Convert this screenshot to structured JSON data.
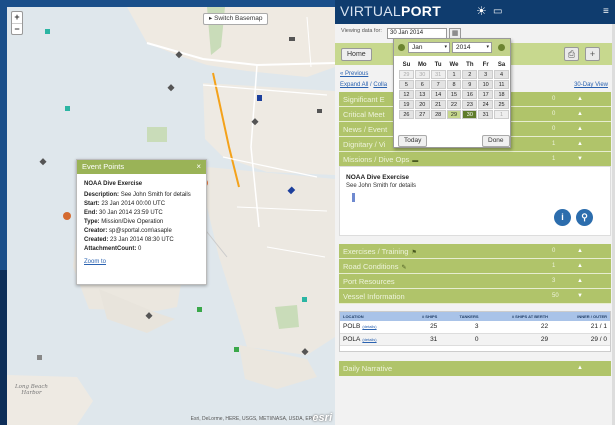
{
  "app": {
    "brand_part1": "VIRTUAL",
    "brand_part2": "PORT"
  },
  "map": {
    "basemap_button": "▸ Switch Basemap",
    "zoom_in": "+",
    "zoom_out": "−",
    "attribution": "Esri, DeLorme, HERE, USGS, METI/NASA, USDA, EPA",
    "esri_logo": "esri",
    "place_label": "Long Beach\nHarbor",
    "popup": {
      "header": "Event Points",
      "close": "×",
      "title": "NOAA Dive Exercise",
      "rows": [
        {
          "label": "Description:",
          "value": "See John Smith for details"
        },
        {
          "label": "Start:",
          "value": "23 Jan 2014 00:00 UTC"
        },
        {
          "label": "End:",
          "value": "30 Jan 2014 23:59 UTC"
        },
        {
          "label": "Type:",
          "value": "Mission/Dive Operation"
        },
        {
          "label": "Creator:",
          "value": "sp@sportal.com\\asaple"
        },
        {
          "label": "Created:",
          "value": "23 Jan 2014 08:30 UTC"
        },
        {
          "label": "AttachmentCount:",
          "value": "0"
        }
      ],
      "zoom_link": "Zoom to"
    }
  },
  "viewing": {
    "label": "Viewing data for:",
    "date": "30 Jan 2014"
  },
  "toolbar": {
    "home": "Home"
  },
  "nav": {
    "previous": "« Previous",
    "expand_all": "Expand All",
    "collapse": "Colla",
    "day_view": "30-Day View"
  },
  "calendar": {
    "month": "Jan",
    "year": "2014",
    "weekdays": [
      "Su",
      "Mo",
      "Tu",
      "We",
      "Th",
      "Fr",
      "Sa"
    ],
    "weeks": [
      [
        "29",
        "30",
        "31",
        "1",
        "2",
        "3",
        "4"
      ],
      [
        "5",
        "6",
        "7",
        "8",
        "9",
        "10",
        "11"
      ],
      [
        "12",
        "13",
        "14",
        "15",
        "16",
        "17",
        "18"
      ],
      [
        "19",
        "20",
        "21",
        "22",
        "23",
        "24",
        "25"
      ],
      [
        "26",
        "27",
        "28",
        "29",
        "30",
        "31",
        "1"
      ]
    ],
    "today_button": "Today",
    "done_button": "Done"
  },
  "sections_top": [
    {
      "label": "Significant E",
      "count": "0",
      "arrow": "▲"
    },
    {
      "label": "Critical Meet",
      "count": "0",
      "arrow": "▲"
    },
    {
      "label": "News / Event",
      "count": "0",
      "arrow": "▲"
    },
    {
      "label": "Dignitary / Vi",
      "count": "1",
      "arrow": "▲"
    },
    {
      "label": "Missions / Dive Ops",
      "count": "1",
      "arrow": "▼"
    }
  ],
  "detail": {
    "title": "NOAA Dive Exercise",
    "description": "See John Smith for details",
    "info_icon": "i",
    "pin_icon": "⚲"
  },
  "sections_bottom": [
    {
      "label": "Exercises / Training",
      "count": "0",
      "arrow": "▲"
    },
    {
      "label": "Road Conditions",
      "count": "1",
      "arrow": "▲"
    },
    {
      "label": "Port Resources",
      "count": "3",
      "arrow": "▲"
    },
    {
      "label": "Vessel Information",
      "count": "50",
      "arrow": "▼"
    }
  ],
  "vessel_table": {
    "headers": [
      "LOCATION",
      "# SHIPS",
      "TANKERS",
      "# SHIPS AT BERTH",
      "INNER / OUTER"
    ],
    "rows": [
      {
        "location": "POLB",
        "detail": "(details)",
        "ships": "25",
        "tankers": "3",
        "berth": "22",
        "inner_outer": "21 / 1"
      },
      {
        "location": "POLA",
        "detail": "(details)",
        "ships": "31",
        "tankers": "0",
        "berth": "29",
        "inner_outer": "29 / 0"
      }
    ]
  },
  "daily": {
    "label": "Daily Narrative",
    "arrow": "▲"
  },
  "colors": {
    "brand_bar": "#0f3c6e",
    "section_green": "#b0c46a",
    "selected_day": "#5f7c2b",
    "popup_header": "#9ab357"
  }
}
